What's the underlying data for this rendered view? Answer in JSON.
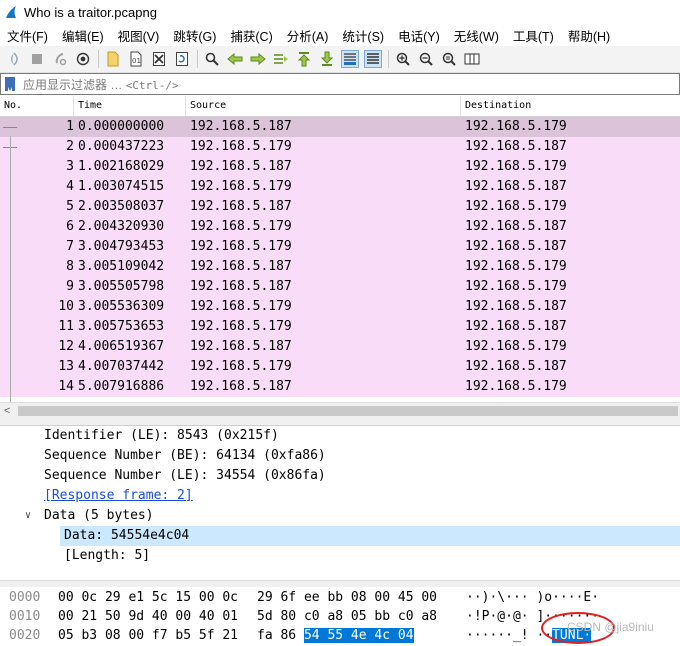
{
  "window": {
    "title": "Who is a traitor.pcapng"
  },
  "menu": [
    "文件(F)",
    "编辑(E)",
    "视图(V)",
    "跳转(G)",
    "捕获(C)",
    "分析(A)",
    "统计(S)",
    "电话(Y)",
    "无线(W)",
    "工具(T)",
    "帮助(H)"
  ],
  "toolbar": {
    "icons": [
      "start-capture-icon",
      "stop-capture-icon",
      "restart-capture-icon",
      "capture-options-icon",
      "open-file-icon",
      "save-file-icon",
      "close-file-icon",
      "reload-file-icon",
      "find-packet-icon",
      "go-back-icon",
      "go-forward-icon",
      "go-to-packet-icon",
      "go-first-icon",
      "go-last-icon",
      "autoscroll-icon",
      "colorize-icon",
      "zoom-in-icon",
      "zoom-out-icon",
      "normal-size-icon",
      "resize-columns-icon"
    ]
  },
  "filter": {
    "placeholder": "应用显示过滤器 …",
    "shortcut": "<Ctrl-/>"
  },
  "columns": [
    "No.",
    "Time",
    "Source",
    "Destination"
  ],
  "packets": [
    {
      "no": "1",
      "time": "0.000000000",
      "src": "192.168.5.187",
      "dst": "192.168.5.179"
    },
    {
      "no": "2",
      "time": "0.000437223",
      "src": "192.168.5.179",
      "dst": "192.168.5.187"
    },
    {
      "no": "3",
      "time": "1.002168029",
      "src": "192.168.5.187",
      "dst": "192.168.5.179"
    },
    {
      "no": "4",
      "time": "1.003074515",
      "src": "192.168.5.179",
      "dst": "192.168.5.187"
    },
    {
      "no": "5",
      "time": "2.003508037",
      "src": "192.168.5.187",
      "dst": "192.168.5.179"
    },
    {
      "no": "6",
      "time": "2.004320930",
      "src": "192.168.5.179",
      "dst": "192.168.5.187"
    },
    {
      "no": "7",
      "time": "3.004793453",
      "src": "192.168.5.179",
      "dst": "192.168.5.187"
    },
    {
      "no": "8",
      "time": "3.005109042",
      "src": "192.168.5.187",
      "dst": "192.168.5.179"
    },
    {
      "no": "9",
      "time": "3.005505798",
      "src": "192.168.5.187",
      "dst": "192.168.5.179"
    },
    {
      "no": "10",
      "time": "3.005536309",
      "src": "192.168.5.179",
      "dst": "192.168.5.187"
    },
    {
      "no": "11",
      "time": "3.005753653",
      "src": "192.168.5.179",
      "dst": "192.168.5.187"
    },
    {
      "no": "12",
      "time": "4.006519367",
      "src": "192.168.5.187",
      "dst": "192.168.5.179"
    },
    {
      "no": "13",
      "time": "4.007037442",
      "src": "192.168.5.179",
      "dst": "192.168.5.187"
    },
    {
      "no": "14",
      "time": "5.007916886",
      "src": "192.168.5.187",
      "dst": "192.168.5.179"
    }
  ],
  "details": {
    "identifier": "Identifier (LE): 8543 (0x215f)",
    "seq_be": "Sequence Number (BE): 64134 (0xfa86)",
    "seq_le": "Sequence Number (LE): 34554 (0x86fa)",
    "response_frame": "[Response frame: 2]",
    "data_header": "Data (5 bytes)",
    "data_value": "Data: 54554e4c04",
    "length": "[Length: 5]"
  },
  "bytes": [
    {
      "offset": "0000",
      "hex1": "00 0c 29 e1 5c 15 00 0c",
      "hex2": "29 6f ee bb 08 00 45 00",
      "hl": "",
      "ascii": "··)·\\··· )o····E·"
    },
    {
      "offset": "0010",
      "hex1": "00 21 50 9d 40 00 40 01",
      "hex2": "5d 80 c0 a8 05 bb c0 a8",
      "hl": "",
      "ascii": "·!P·@·@· ]·······"
    },
    {
      "offset": "0020",
      "hex1": "05 b3 08 00 f7 b5 5f 21",
      "hex2": "fa 86 ",
      "hl": "54 55 4e 4c 04",
      "ascii": "······_! ··",
      "ascii_hl": "TUNL·"
    }
  ],
  "watermark": "CSDN @jia9iniu",
  "colors": {
    "row": "#f9dcf7",
    "row_selected": "#dbc3da",
    "detail_selected": "#cce8ff",
    "byte_highlight": "#0078d7",
    "annotation": "#e02020"
  }
}
